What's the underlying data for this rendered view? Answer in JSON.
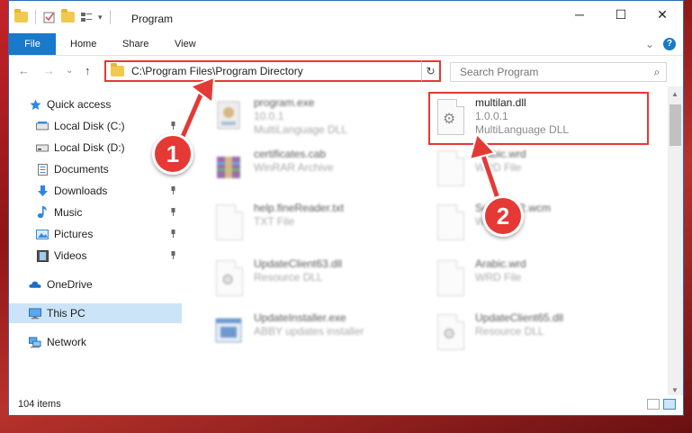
{
  "window": {
    "title": "Program",
    "caption": {
      "minimize": "─",
      "maximize": "☐",
      "close": "✕"
    }
  },
  "ribbon": {
    "tabs": [
      "File",
      "Home",
      "Share",
      "View"
    ],
    "expand": "⌄",
    "help": "?"
  },
  "nav": {
    "back": "←",
    "forward": "→",
    "recent": "⌄",
    "up": "↑",
    "address": "C:\\Program Files\\Program Directory",
    "refresh": "↻",
    "search_placeholder": "Search Program"
  },
  "sidebar": {
    "items": [
      {
        "label": "Quick access",
        "icon": "star-icon",
        "pinned": false
      },
      {
        "label": "Local Disk (C:)",
        "icon": "drive-icon",
        "pinned": true
      },
      {
        "label": "Local Disk (D:)",
        "icon": "drive-icon",
        "pinned": true
      },
      {
        "label": "Documents",
        "icon": "documents-icon",
        "pinned": true
      },
      {
        "label": "Downloads",
        "icon": "download-icon",
        "pinned": true
      },
      {
        "label": "Music",
        "icon": "music-icon",
        "pinned": true
      },
      {
        "label": "Pictures",
        "icon": "pictures-icon",
        "pinned": true
      },
      {
        "label": "Videos",
        "icon": "video-icon",
        "pinned": true
      },
      {
        "label": "OneDrive",
        "icon": "cloud-icon",
        "pinned": false
      },
      {
        "label": "This PC",
        "icon": "pc-icon",
        "pinned": false,
        "selected": true
      },
      {
        "label": "Network",
        "icon": "network-icon",
        "pinned": false
      }
    ]
  },
  "files": [
    {
      "name": "program.exe",
      "line2": "10.0.1",
      "line3": "MultiLanguage DLL",
      "icon": "exe-icon"
    },
    {
      "name": "multilan.dll",
      "line2": "1.0.0.1",
      "line3": "MultiLanguage DLL",
      "icon": "dll-icon",
      "highlighted": true
    },
    {
      "name": "certificates.cab",
      "line2": "WinRAR Archive",
      "icon": "archive-icon"
    },
    {
      "name": "Arabic.wrd",
      "line2": "WRD File",
      "icon": "file-icon"
    },
    {
      "name": "help.fineReader.txt",
      "line2": "TXT File",
      "icon": "file-icon"
    },
    {
      "name": "Setup.P12.wcm",
      "line2": "WCM File",
      "icon": "file-icon"
    },
    {
      "name": "UpdateClient63.dll",
      "line2": "Resource DLL",
      "icon": "dll-icon"
    },
    {
      "name": "Arabic.wrd",
      "line2": "WRD File",
      "icon": "file-icon"
    },
    {
      "name": "UpdateInstaller.exe",
      "line2": "ABBY updates installer",
      "icon": "exe-icon"
    },
    {
      "name": "UpdateClient65.dll",
      "line2": "Resource DLL",
      "icon": "dll-icon"
    }
  ],
  "status": {
    "count": "104 items"
  },
  "callouts": [
    {
      "label": "1"
    },
    {
      "label": "2"
    }
  ],
  "colors": {
    "accent": "#1979ca",
    "highlight": "#e53935"
  }
}
